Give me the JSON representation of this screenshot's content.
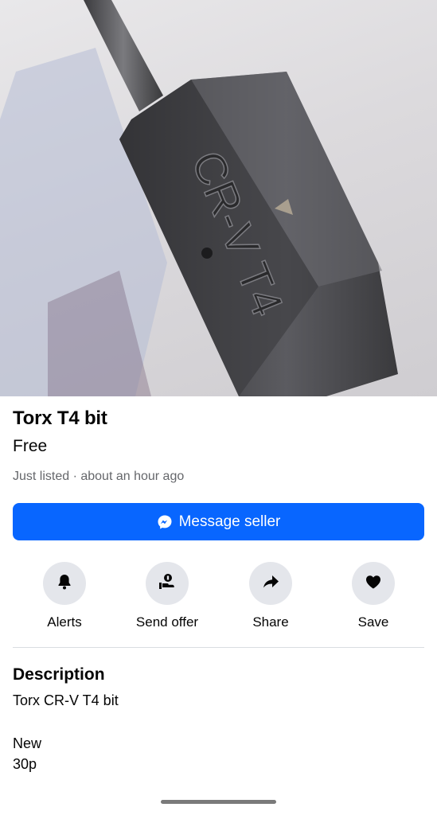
{
  "listing": {
    "title": "Torx T4 bit",
    "price": "Free",
    "meta": "Just listed · about an hour ago",
    "image_engraving": "CR-V T4"
  },
  "message_button": {
    "label": "Message seller",
    "icon": "messenger-icon",
    "color": "#0866ff"
  },
  "actions": [
    {
      "label": "Alerts",
      "icon": "bell-icon"
    },
    {
      "label": "Send offer",
      "icon": "send-offer-icon"
    },
    {
      "label": "Share",
      "icon": "share-arrow-icon"
    },
    {
      "label": "Save",
      "icon": "heart-icon"
    }
  ],
  "description": {
    "heading": "Description",
    "lines": [
      "Torx CR-V T4 bit",
      "New",
      "30p"
    ]
  }
}
